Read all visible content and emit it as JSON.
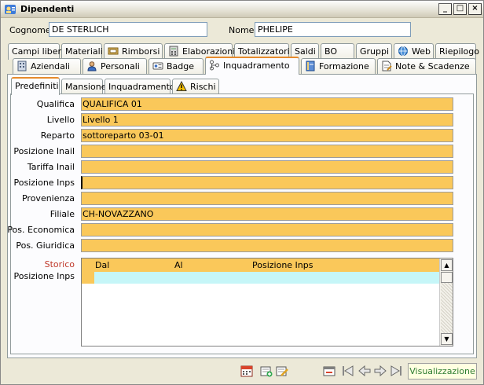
{
  "window": {
    "title": "Dipendenti",
    "controls": {
      "minimize": "_",
      "maximize": "□",
      "close": "×"
    }
  },
  "header": {
    "cognome_label": "Cognome",
    "cognome_value": "DE STERLICH",
    "nome_label": "Nome",
    "nome_value": "PHELIPE"
  },
  "tabs_row1": [
    "Campi liberi",
    "Materiali",
    "Rimborsi",
    "Elaborazioni",
    "Totalizzatori",
    "Saldi",
    "BO",
    "Gruppi",
    "Web",
    "Riepilogo"
  ],
  "tabs_row2": [
    "Aziendali",
    "Personali",
    "Badge",
    "Inquadramento",
    "Formazione",
    "Note & Scadenze"
  ],
  "active_tab": "Inquadramento",
  "subtabs": [
    "Predefiniti",
    "Mansione",
    "Inquadramento",
    "Rischi"
  ],
  "active_subtab": "Predefiniti",
  "fields": [
    {
      "label": "Qualifica",
      "value": "QUALIFICA 01"
    },
    {
      "label": "Livello",
      "value": "Livello 1"
    },
    {
      "label": "Reparto",
      "value": "sottoreparto 03-01"
    },
    {
      "label": "Posizione Inail",
      "value": ""
    },
    {
      "label": "Tariffa Inail",
      "value": ""
    },
    {
      "label": "Posizione Inps",
      "value": ""
    },
    {
      "label": "Provenienza",
      "value": ""
    },
    {
      "label": "Filiale",
      "value": "CH-NOVAZZANO"
    },
    {
      "label": "Pos. Economica",
      "value": ""
    },
    {
      "label": "Pos. Giuridica",
      "value": ""
    }
  ],
  "storico": {
    "title": "Storico",
    "subtitle": "Posizione Inps",
    "columns": [
      "Dal",
      "Al",
      "Posizione Inps"
    ],
    "rows": [
      [
        "",
        "",
        ""
      ]
    ]
  },
  "toolbar": {
    "icons": [
      "calendar-icon",
      "add-record-icon",
      "edit-record-icon",
      "delete-record-icon",
      "first-record-icon",
      "previous-record-icon",
      "next-record-icon",
      "last-record-icon"
    ],
    "status": "Visualizzazione"
  },
  "colors": {
    "field_background": "#FAC85A",
    "selected_row": "#C6F6F8",
    "storico_title": "#C0392B",
    "status_text": "#2E7D32",
    "active_tab_accent": "#E68B2C"
  }
}
